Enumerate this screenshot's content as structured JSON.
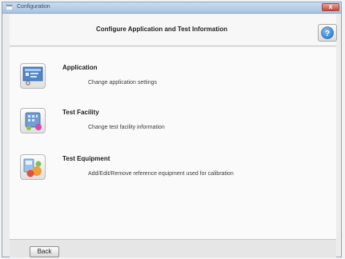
{
  "window": {
    "title": "Configuration",
    "close_label": "x"
  },
  "header": {
    "title": "Configure Application and Test Information",
    "help_icon": "help-icon",
    "help_label": "?"
  },
  "items": [
    {
      "title": "Application",
      "description": "Change application settings",
      "icon": "application-settings-icon"
    },
    {
      "title": "Test Facility",
      "description": "Change test facility information",
      "icon": "test-facility-icon"
    },
    {
      "title": "Test Equipment",
      "description": "Add/Edit/Remove reference equipment used for calibration",
      "icon": "test-equipment-icon"
    }
  ],
  "footer": {
    "back_label": "Back"
  },
  "colors": {
    "titlebar": "#a9c4e2",
    "help_blue": "#2f7fd0",
    "close_red": "#c9473a"
  }
}
